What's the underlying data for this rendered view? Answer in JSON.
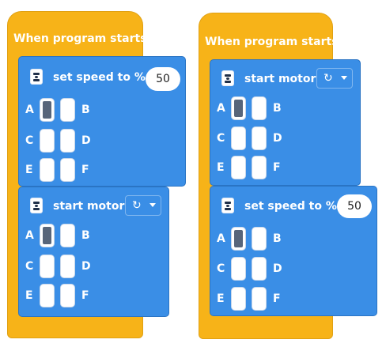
{
  "stacks": [
    {
      "hat_title": "When program starts",
      "blocks": [
        {
          "type": "set_speed",
          "label": "set speed to %",
          "value": "50",
          "ports": {
            "A": "A",
            "B": "B",
            "C": "C",
            "D": "D",
            "E": "E",
            "F": "F"
          },
          "selected_port": "A"
        },
        {
          "type": "start_motor",
          "label": "start motor",
          "direction_icon": "rotate-clockwise-icon",
          "ports": {
            "A": "A",
            "B": "B",
            "C": "C",
            "D": "D",
            "E": "E",
            "F": "F"
          },
          "selected_port": "A"
        }
      ]
    },
    {
      "hat_title": "When program starts",
      "blocks": [
        {
          "type": "start_motor",
          "label": "start motor",
          "direction_icon": "rotate-clockwise-icon",
          "ports": {
            "A": "A",
            "B": "B",
            "C": "C",
            "D": "D",
            "E": "E",
            "F": "F"
          },
          "selected_port": "A"
        },
        {
          "type": "set_speed",
          "label": "set speed to %",
          "value": "50",
          "ports": {
            "A": "A",
            "B": "B",
            "C": "C",
            "D": "D",
            "E": "E",
            "F": "F"
          },
          "selected_port": "A"
        }
      ]
    }
  ],
  "colors": {
    "hat": "#f7b318",
    "block": "#3a8ee6",
    "port_selected": "#57657a"
  }
}
